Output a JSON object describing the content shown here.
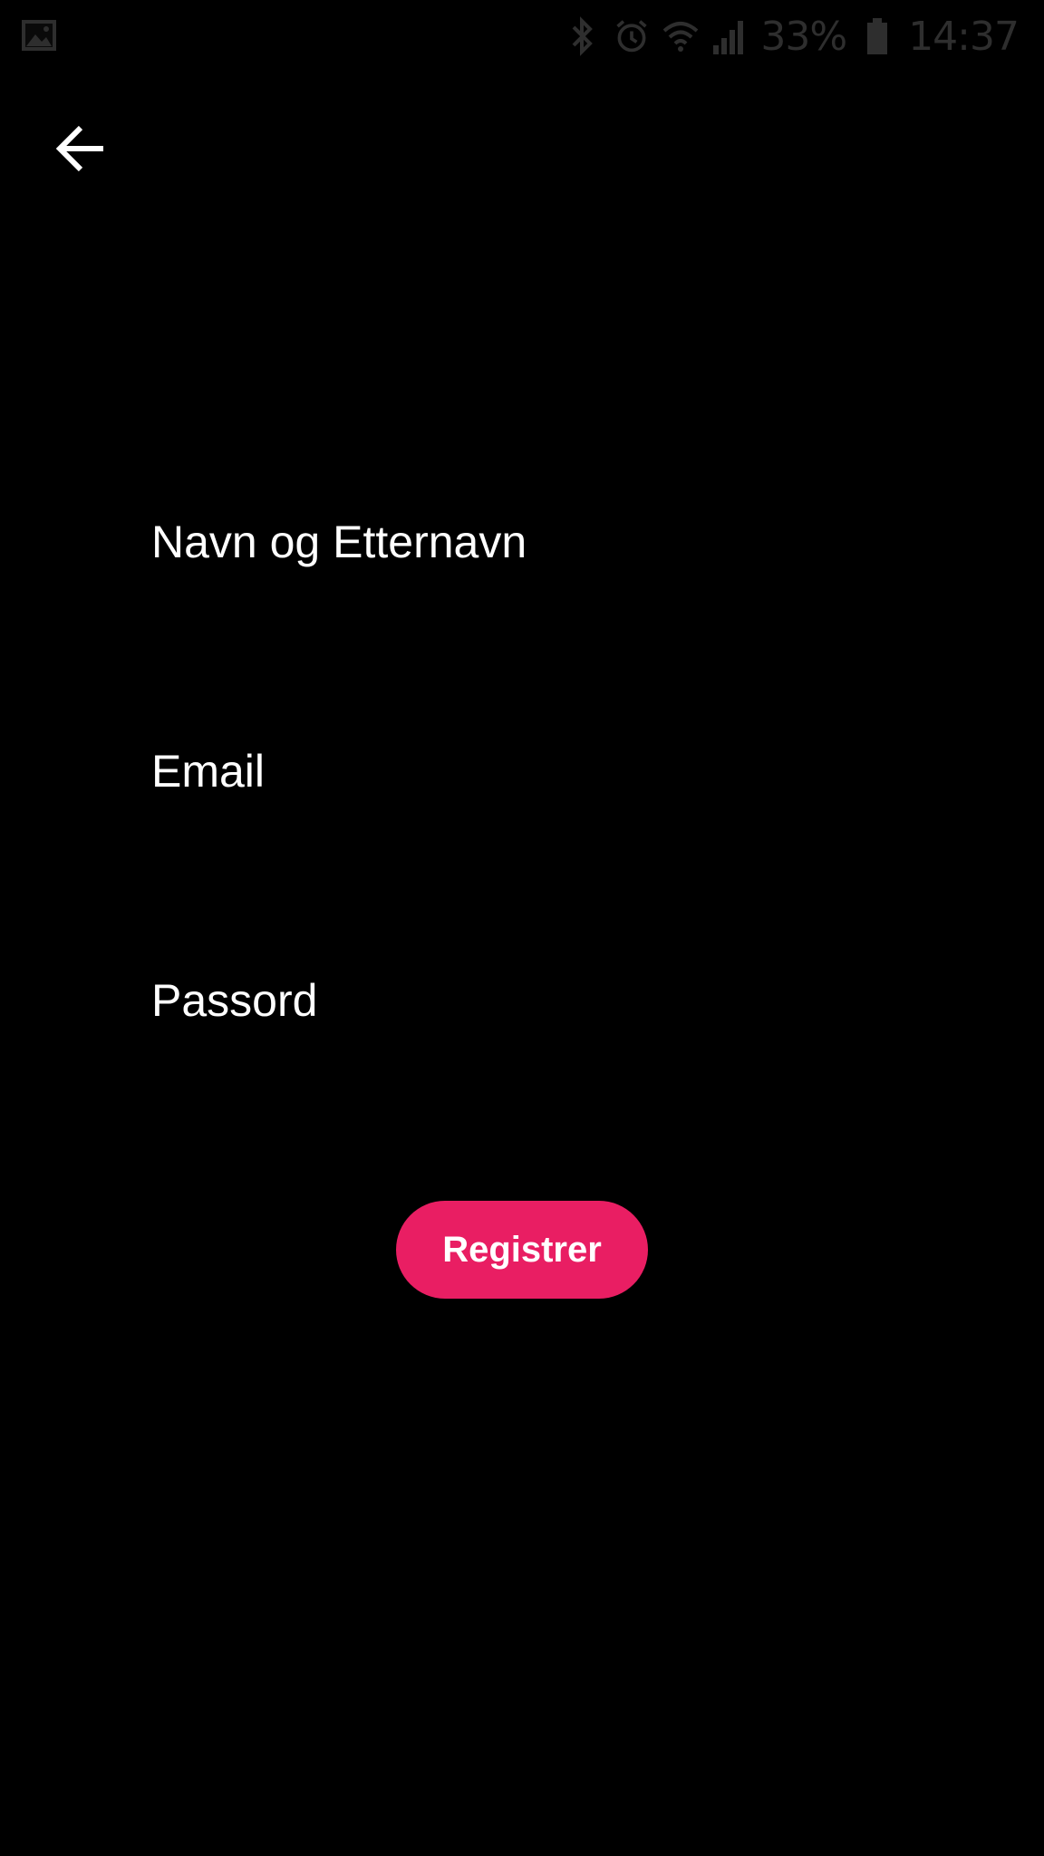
{
  "status_bar": {
    "battery_percent": "33%",
    "time": "14:37",
    "icons": [
      "gallery-icon",
      "bluetooth-icon",
      "alarm-icon",
      "wifi-icon",
      "signal-icon",
      "battery-icon"
    ]
  },
  "header": {
    "back_icon": "arrow-back-icon"
  },
  "form": {
    "name_placeholder": "Navn og Etternavn",
    "email_placeholder": "Email",
    "password_placeholder": "Passord",
    "name_value": "",
    "email_value": "",
    "password_value": ""
  },
  "actions": {
    "register_label": "Registrer"
  },
  "colors": {
    "background": "#000000",
    "accent": "#e91e63",
    "text": "#ffffff",
    "status_icons": "#2e2e2e"
  }
}
